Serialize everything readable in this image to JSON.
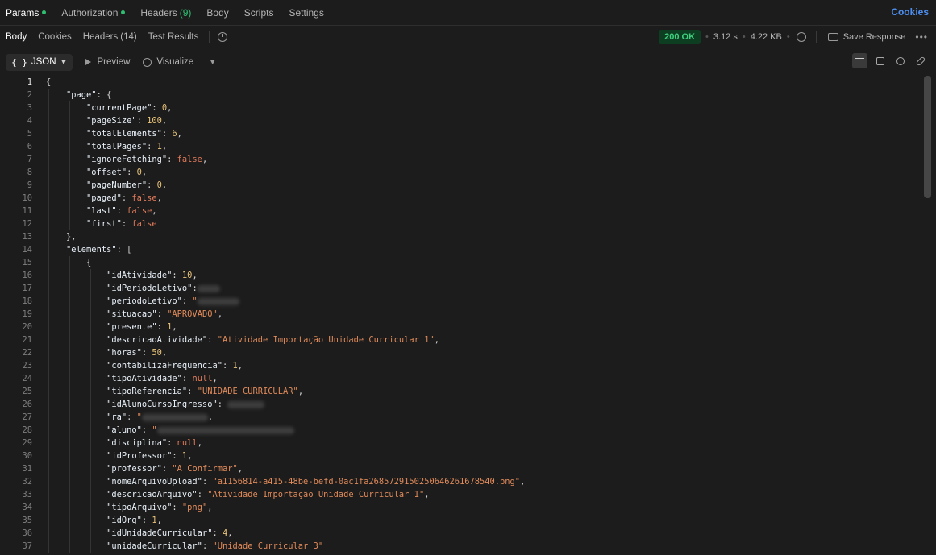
{
  "request_tabs": [
    {
      "label": "Params",
      "dot": true,
      "active": true
    },
    {
      "label": "Authorization",
      "dot": true
    },
    {
      "label": "Headers",
      "count": "(9)"
    },
    {
      "label": "Body"
    },
    {
      "label": "Scripts"
    },
    {
      "label": "Settings"
    }
  ],
  "cookies_link": "Cookies",
  "response_tabs": [
    {
      "label": "Body",
      "active": true
    },
    {
      "label": "Cookies"
    },
    {
      "label": "Headers",
      "count": "(14)"
    },
    {
      "label": "Test Results"
    }
  ],
  "response_meta": {
    "status": "200 OK",
    "time": "3.12 s",
    "size": "4.22 KB",
    "save_label": "Save Response",
    "status_color": "#3fd07e"
  },
  "view_bar": {
    "format": "JSON",
    "preview": "Preview",
    "visualize": "Visualize"
  },
  "code_lines": [
    {
      "n": 1,
      "indent": 0,
      "t": [
        [
          "p",
          "{"
        ]
      ]
    },
    {
      "n": 2,
      "indent": 1,
      "t": [
        [
          "key",
          "\"page\""
        ],
        [
          "p",
          ": {"
        ]
      ]
    },
    {
      "n": 3,
      "indent": 2,
      "t": [
        [
          "key",
          "\"currentPage\""
        ],
        [
          "p",
          ": "
        ],
        [
          "n",
          "0"
        ],
        [
          "p",
          ","
        ]
      ]
    },
    {
      "n": 4,
      "indent": 2,
      "t": [
        [
          "key",
          "\"pageSize\""
        ],
        [
          "p",
          ": "
        ],
        [
          "n",
          "100"
        ],
        [
          "p",
          ","
        ]
      ]
    },
    {
      "n": 5,
      "indent": 2,
      "t": [
        [
          "key",
          "\"totalElements\""
        ],
        [
          "p",
          ": "
        ],
        [
          "n",
          "6"
        ],
        [
          "p",
          ","
        ]
      ]
    },
    {
      "n": 6,
      "indent": 2,
      "t": [
        [
          "key",
          "\"totalPages\""
        ],
        [
          "p",
          ": "
        ],
        [
          "n",
          "1"
        ],
        [
          "p",
          ","
        ]
      ]
    },
    {
      "n": 7,
      "indent": 2,
      "t": [
        [
          "key",
          "\"ignoreFetching\""
        ],
        [
          "p",
          ": "
        ],
        [
          "b",
          "false"
        ],
        [
          "p",
          ","
        ]
      ]
    },
    {
      "n": 8,
      "indent": 2,
      "t": [
        [
          "key",
          "\"offset\""
        ],
        [
          "p",
          ": "
        ],
        [
          "n",
          "0"
        ],
        [
          "p",
          ","
        ]
      ]
    },
    {
      "n": 9,
      "indent": 2,
      "t": [
        [
          "key",
          "\"pageNumber\""
        ],
        [
          "p",
          ": "
        ],
        [
          "n",
          "0"
        ],
        [
          "p",
          ","
        ]
      ]
    },
    {
      "n": 10,
      "indent": 2,
      "t": [
        [
          "key",
          "\"paged\""
        ],
        [
          "p",
          ": "
        ],
        [
          "b",
          "false"
        ],
        [
          "p",
          ","
        ]
      ]
    },
    {
      "n": 11,
      "indent": 2,
      "t": [
        [
          "key",
          "\"last\""
        ],
        [
          "p",
          ": "
        ],
        [
          "b",
          "false"
        ],
        [
          "p",
          ","
        ]
      ]
    },
    {
      "n": 12,
      "indent": 2,
      "t": [
        [
          "key",
          "\"first\""
        ],
        [
          "p",
          ": "
        ],
        [
          "b",
          "false"
        ]
      ]
    },
    {
      "n": 13,
      "indent": 1,
      "t": [
        [
          "p",
          "},"
        ]
      ]
    },
    {
      "n": 14,
      "indent": 1,
      "t": [
        [
          "key",
          "\"elements\""
        ],
        [
          "p",
          ": ["
        ]
      ]
    },
    {
      "n": 15,
      "indent": 2,
      "t": [
        [
          "p",
          "{"
        ]
      ]
    },
    {
      "n": 16,
      "indent": 3,
      "t": [
        [
          "key",
          "\"idAtividade\""
        ],
        [
          "p",
          ": "
        ],
        [
          "n",
          "10"
        ],
        [
          "p",
          ","
        ]
      ]
    },
    {
      "n": 17,
      "indent": 3,
      "t": [
        [
          "key",
          "\"idPeriodoLetivo\""
        ],
        [
          "p",
          ":"
        ],
        [
          "r",
          "28"
        ]
      ]
    },
    {
      "n": 18,
      "indent": 3,
      "t": [
        [
          "key",
          "\"periodoLetivo\""
        ],
        [
          "p",
          ": "
        ],
        [
          "s",
          "\""
        ],
        [
          "r",
          "52"
        ]
      ]
    },
    {
      "n": 19,
      "indent": 3,
      "t": [
        [
          "key",
          "\"situacao\""
        ],
        [
          "p",
          ": "
        ],
        [
          "s",
          "\"APROVADO\""
        ],
        [
          "p",
          ","
        ]
      ]
    },
    {
      "n": 20,
      "indent": 3,
      "t": [
        [
          "key",
          "\"presente\""
        ],
        [
          "p",
          ": "
        ],
        [
          "n",
          "1"
        ],
        [
          "p",
          ","
        ]
      ]
    },
    {
      "n": 21,
      "indent": 3,
      "t": [
        [
          "key",
          "\"descricaoAtividade\""
        ],
        [
          "p",
          ": "
        ],
        [
          "s",
          "\"Atividade Importação Unidade Curricular 1\""
        ],
        [
          "p",
          ","
        ]
      ]
    },
    {
      "n": 22,
      "indent": 3,
      "t": [
        [
          "key",
          "\"horas\""
        ],
        [
          "p",
          ": "
        ],
        [
          "n",
          "50"
        ],
        [
          "p",
          ","
        ]
      ]
    },
    {
      "n": 23,
      "indent": 3,
      "t": [
        [
          "key",
          "\"contabilizaFrequencia\""
        ],
        [
          "p",
          ": "
        ],
        [
          "n",
          "1"
        ],
        [
          "p",
          ","
        ]
      ]
    },
    {
      "n": 24,
      "indent": 3,
      "t": [
        [
          "key",
          "\"tipoAtividade\""
        ],
        [
          "p",
          ": "
        ],
        [
          "nl",
          "null"
        ],
        [
          "p",
          ","
        ]
      ]
    },
    {
      "n": 25,
      "indent": 3,
      "t": [
        [
          "key",
          "\"tipoReferencia\""
        ],
        [
          "p",
          ": "
        ],
        [
          "s",
          "\"UNIDADE_CURRICULAR\""
        ],
        [
          "p",
          ","
        ]
      ]
    },
    {
      "n": 26,
      "indent": 3,
      "t": [
        [
          "key",
          "\"idAlunoCursoIngresso\""
        ],
        [
          "p",
          ": "
        ],
        [
          "r",
          "46"
        ]
      ]
    },
    {
      "n": 27,
      "indent": 3,
      "t": [
        [
          "key",
          "\"ra\""
        ],
        [
          "p",
          ": "
        ],
        [
          "s",
          "\""
        ],
        [
          "r",
          "82"
        ],
        [
          "p",
          ","
        ]
      ]
    },
    {
      "n": 28,
      "indent": 3,
      "t": [
        [
          "key",
          "\"aluno\""
        ],
        [
          "p",
          ": "
        ],
        [
          "s",
          "\""
        ],
        [
          "r",
          "170"
        ]
      ]
    },
    {
      "n": 29,
      "indent": 3,
      "t": [
        [
          "key",
          "\"disciplina\""
        ],
        [
          "p",
          ": "
        ],
        [
          "nl",
          "null"
        ],
        [
          "p",
          ","
        ]
      ]
    },
    {
      "n": 30,
      "indent": 3,
      "t": [
        [
          "key",
          "\"idProfessor\""
        ],
        [
          "p",
          ": "
        ],
        [
          "n",
          "1"
        ],
        [
          "p",
          ","
        ]
      ]
    },
    {
      "n": 31,
      "indent": 3,
      "t": [
        [
          "key",
          "\"professor\""
        ],
        [
          "p",
          ": "
        ],
        [
          "s",
          "\"A Confirmar\""
        ],
        [
          "p",
          ","
        ]
      ]
    },
    {
      "n": 32,
      "indent": 3,
      "t": [
        [
          "key",
          "\"nomeArquivoUpload\""
        ],
        [
          "p",
          ": "
        ],
        [
          "s",
          "\"a1156814-a415-48be-befd-0ac1fa268572915025064626167854​0.png\""
        ],
        [
          "p",
          ","
        ]
      ]
    },
    {
      "n": 33,
      "indent": 3,
      "t": [
        [
          "key",
          "\"descricaoArquivo\""
        ],
        [
          "p",
          ": "
        ],
        [
          "s",
          "\"Atividade Importação Unidade Curricular 1\""
        ],
        [
          "p",
          ","
        ]
      ]
    },
    {
      "n": 34,
      "indent": 3,
      "t": [
        [
          "key",
          "\"tipoArquivo\""
        ],
        [
          "p",
          ": "
        ],
        [
          "s",
          "\"png\""
        ],
        [
          "p",
          ","
        ]
      ]
    },
    {
      "n": 35,
      "indent": 3,
      "t": [
        [
          "key",
          "\"idOrg\""
        ],
        [
          "p",
          ": "
        ],
        [
          "n",
          "1"
        ],
        [
          "p",
          ","
        ]
      ]
    },
    {
      "n": 36,
      "indent": 3,
      "t": [
        [
          "key",
          "\"idUnidadeCurricular\""
        ],
        [
          "p",
          ": "
        ],
        [
          "n",
          "4"
        ],
        [
          "p",
          ","
        ]
      ]
    },
    {
      "n": 37,
      "indent": 3,
      "t": [
        [
          "key",
          "\"unidadeCurricular\""
        ],
        [
          "p",
          ": "
        ],
        [
          "s",
          "\"Unidade Curricular 3\""
        ]
      ]
    }
  ]
}
